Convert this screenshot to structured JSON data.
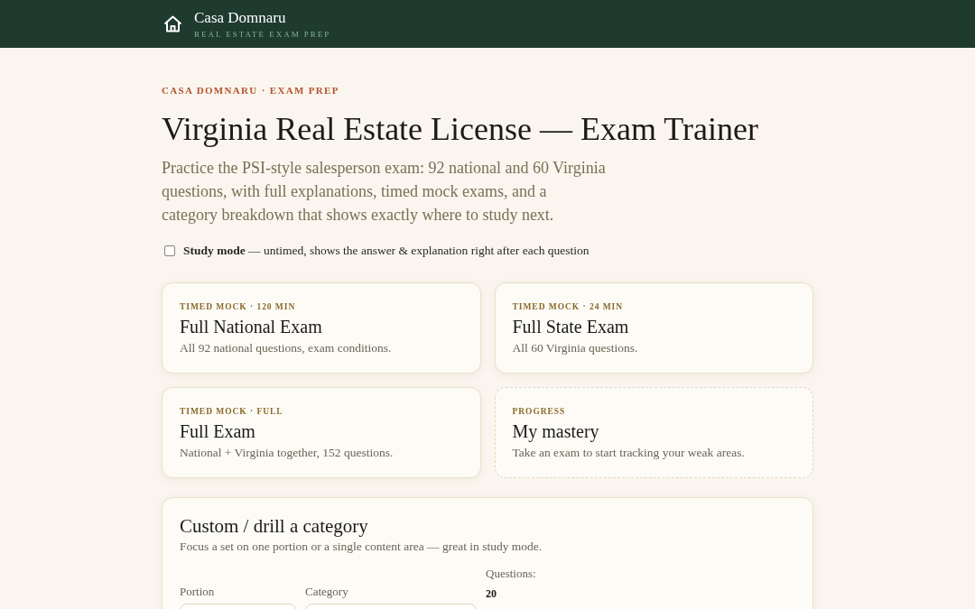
{
  "header": {
    "brand": "Casa Domnaru",
    "tagline": "REAL ESTATE EXAM PREP"
  },
  "kicker": "CASA DOMNARU · EXAM PREP",
  "title": "Virginia Real Estate License — Exam Trainer",
  "intro": "Practice the PSI-style salesperson exam: 92 national and 60 Virginia questions, with full explanations, timed mock exams, and a category breakdown that shows exactly where to study next.",
  "study_mode": {
    "checked": false,
    "text": "**Study mode** — untimed, shows the answer & explanation right after each question"
  },
  "cards": [
    {
      "kind": "exam",
      "eyebrow": "TIMED MOCK · 120 MIN",
      "title": "Full National Exam",
      "description": "All 92 national questions, exam conditions."
    },
    {
      "kind": "exam",
      "eyebrow": "TIMED MOCK · 24 MIN",
      "title": "Full State Exam",
      "description": "All 60 Virginia questions."
    },
    {
      "kind": "exam",
      "eyebrow": "TIMED MOCK · FULL",
      "title": "Full Exam",
      "description": "National + Virginia together, 152 questions."
    },
    {
      "kind": "progress",
      "eyebrow": "PROGRESS",
      "title": "My mastery",
      "description": "Take an exam to start tracking your weak areas."
    }
  ],
  "custom": {
    "title": "Custom / drill a category",
    "description": "Focus a set on one portion or a single content area — great in study mode.",
    "fields": [
      {
        "label": "Portion"
      },
      {
        "label": "Category"
      }
    ],
    "questions": {
      "label": "Questions:",
      "value": "20"
    }
  }
}
